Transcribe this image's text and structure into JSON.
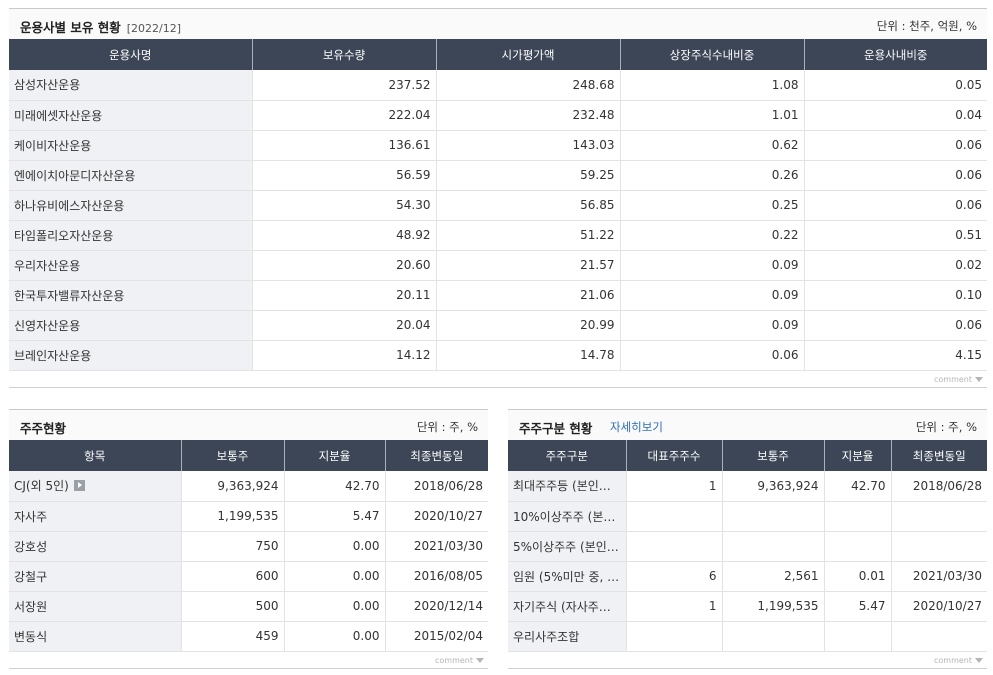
{
  "holdings": {
    "title": "운용사별 보유 현황",
    "period": "[2022/12]",
    "unit": "단위 : 천주, 억원, %",
    "columns": [
      "운용사명",
      "보유수량",
      "시가평가액",
      "상장주식수내비중",
      "운용사내비중"
    ],
    "rows": [
      {
        "name": "삼성자산운용",
        "qty": "237.52",
        "value": "248.68",
        "share": "1.08",
        "inner": "0.05"
      },
      {
        "name": "미래에셋자산운용",
        "qty": "222.04",
        "value": "232.48",
        "share": "1.01",
        "inner": "0.04"
      },
      {
        "name": "케이비자산운용",
        "qty": "136.61",
        "value": "143.03",
        "share": "0.62",
        "inner": "0.06"
      },
      {
        "name": "엔에이치아문디자산운용",
        "qty": "56.59",
        "value": "59.25",
        "share": "0.26",
        "inner": "0.06"
      },
      {
        "name": "하나유비에스자산운용",
        "qty": "54.30",
        "value": "56.85",
        "share": "0.25",
        "inner": "0.06"
      },
      {
        "name": "타임폴리오자산운용",
        "qty": "48.92",
        "value": "51.22",
        "share": "0.22",
        "inner": "0.51"
      },
      {
        "name": "우리자산운용",
        "qty": "20.60",
        "value": "21.57",
        "share": "0.09",
        "inner": "0.02"
      },
      {
        "name": "한국투자밸류자산운용",
        "qty": "20.11",
        "value": "21.06",
        "share": "0.09",
        "inner": "0.10"
      },
      {
        "name": "신영자산운용",
        "qty": "20.04",
        "value": "20.99",
        "share": "0.09",
        "inner": "0.06"
      },
      {
        "name": "브레인자산운용",
        "qty": "14.12",
        "value": "14.78",
        "share": "0.06",
        "inner": "4.15"
      }
    ],
    "comment_label": "comment"
  },
  "shareholders": {
    "title": "주주현황",
    "unit": "단위 : 주, %",
    "columns": [
      "항목",
      "보통주",
      "지분율",
      "최종변동일"
    ],
    "rows": [
      {
        "name": "CJ(외 5인)",
        "shares": "9,363,924",
        "ratio": "42.70",
        "date": "2018/06/28",
        "more": true
      },
      {
        "name": "자사주",
        "shares": "1,199,535",
        "ratio": "5.47",
        "date": "2020/10/27"
      },
      {
        "name": "강호성",
        "shares": "750",
        "ratio": "0.00",
        "date": "2021/03/30"
      },
      {
        "name": "강철구",
        "shares": "600",
        "ratio": "0.00",
        "date": "2016/08/05"
      },
      {
        "name": "서장원",
        "shares": "500",
        "ratio": "0.00",
        "date": "2020/12/14"
      },
      {
        "name": "변동식",
        "shares": "459",
        "ratio": "0.00",
        "date": "2015/02/04"
      }
    ],
    "comment_label": "comment"
  },
  "holder_types": {
    "title": "주주구분 현황",
    "detail_link": "자세히보기",
    "unit": "단위 : 주, %",
    "columns": [
      "주주구분",
      "대표주주수",
      "보통주",
      "지분율",
      "최종변동일"
    ],
    "rows": [
      {
        "name": "최대주주등 (본인…",
        "count": "1",
        "shares": "9,363,924",
        "ratio": "42.70",
        "date": "2018/06/28"
      },
      {
        "name": "10%이상주주 (본…",
        "count": "",
        "shares": "",
        "ratio": "",
        "date": ""
      },
      {
        "name": "5%이상주주 (본인…",
        "count": "",
        "shares": "",
        "ratio": "",
        "date": ""
      },
      {
        "name": "임원 (5%미만 중, …",
        "count": "6",
        "shares": "2,561",
        "ratio": "0.01",
        "date": "2021/03/30"
      },
      {
        "name": "자기주식 (자사주…",
        "count": "1",
        "shares": "1,199,535",
        "ratio": "5.47",
        "date": "2020/10/27"
      },
      {
        "name": "우리사주조합",
        "count": "",
        "shares": "",
        "ratio": "",
        "date": ""
      }
    ],
    "comment_label": "comment"
  }
}
